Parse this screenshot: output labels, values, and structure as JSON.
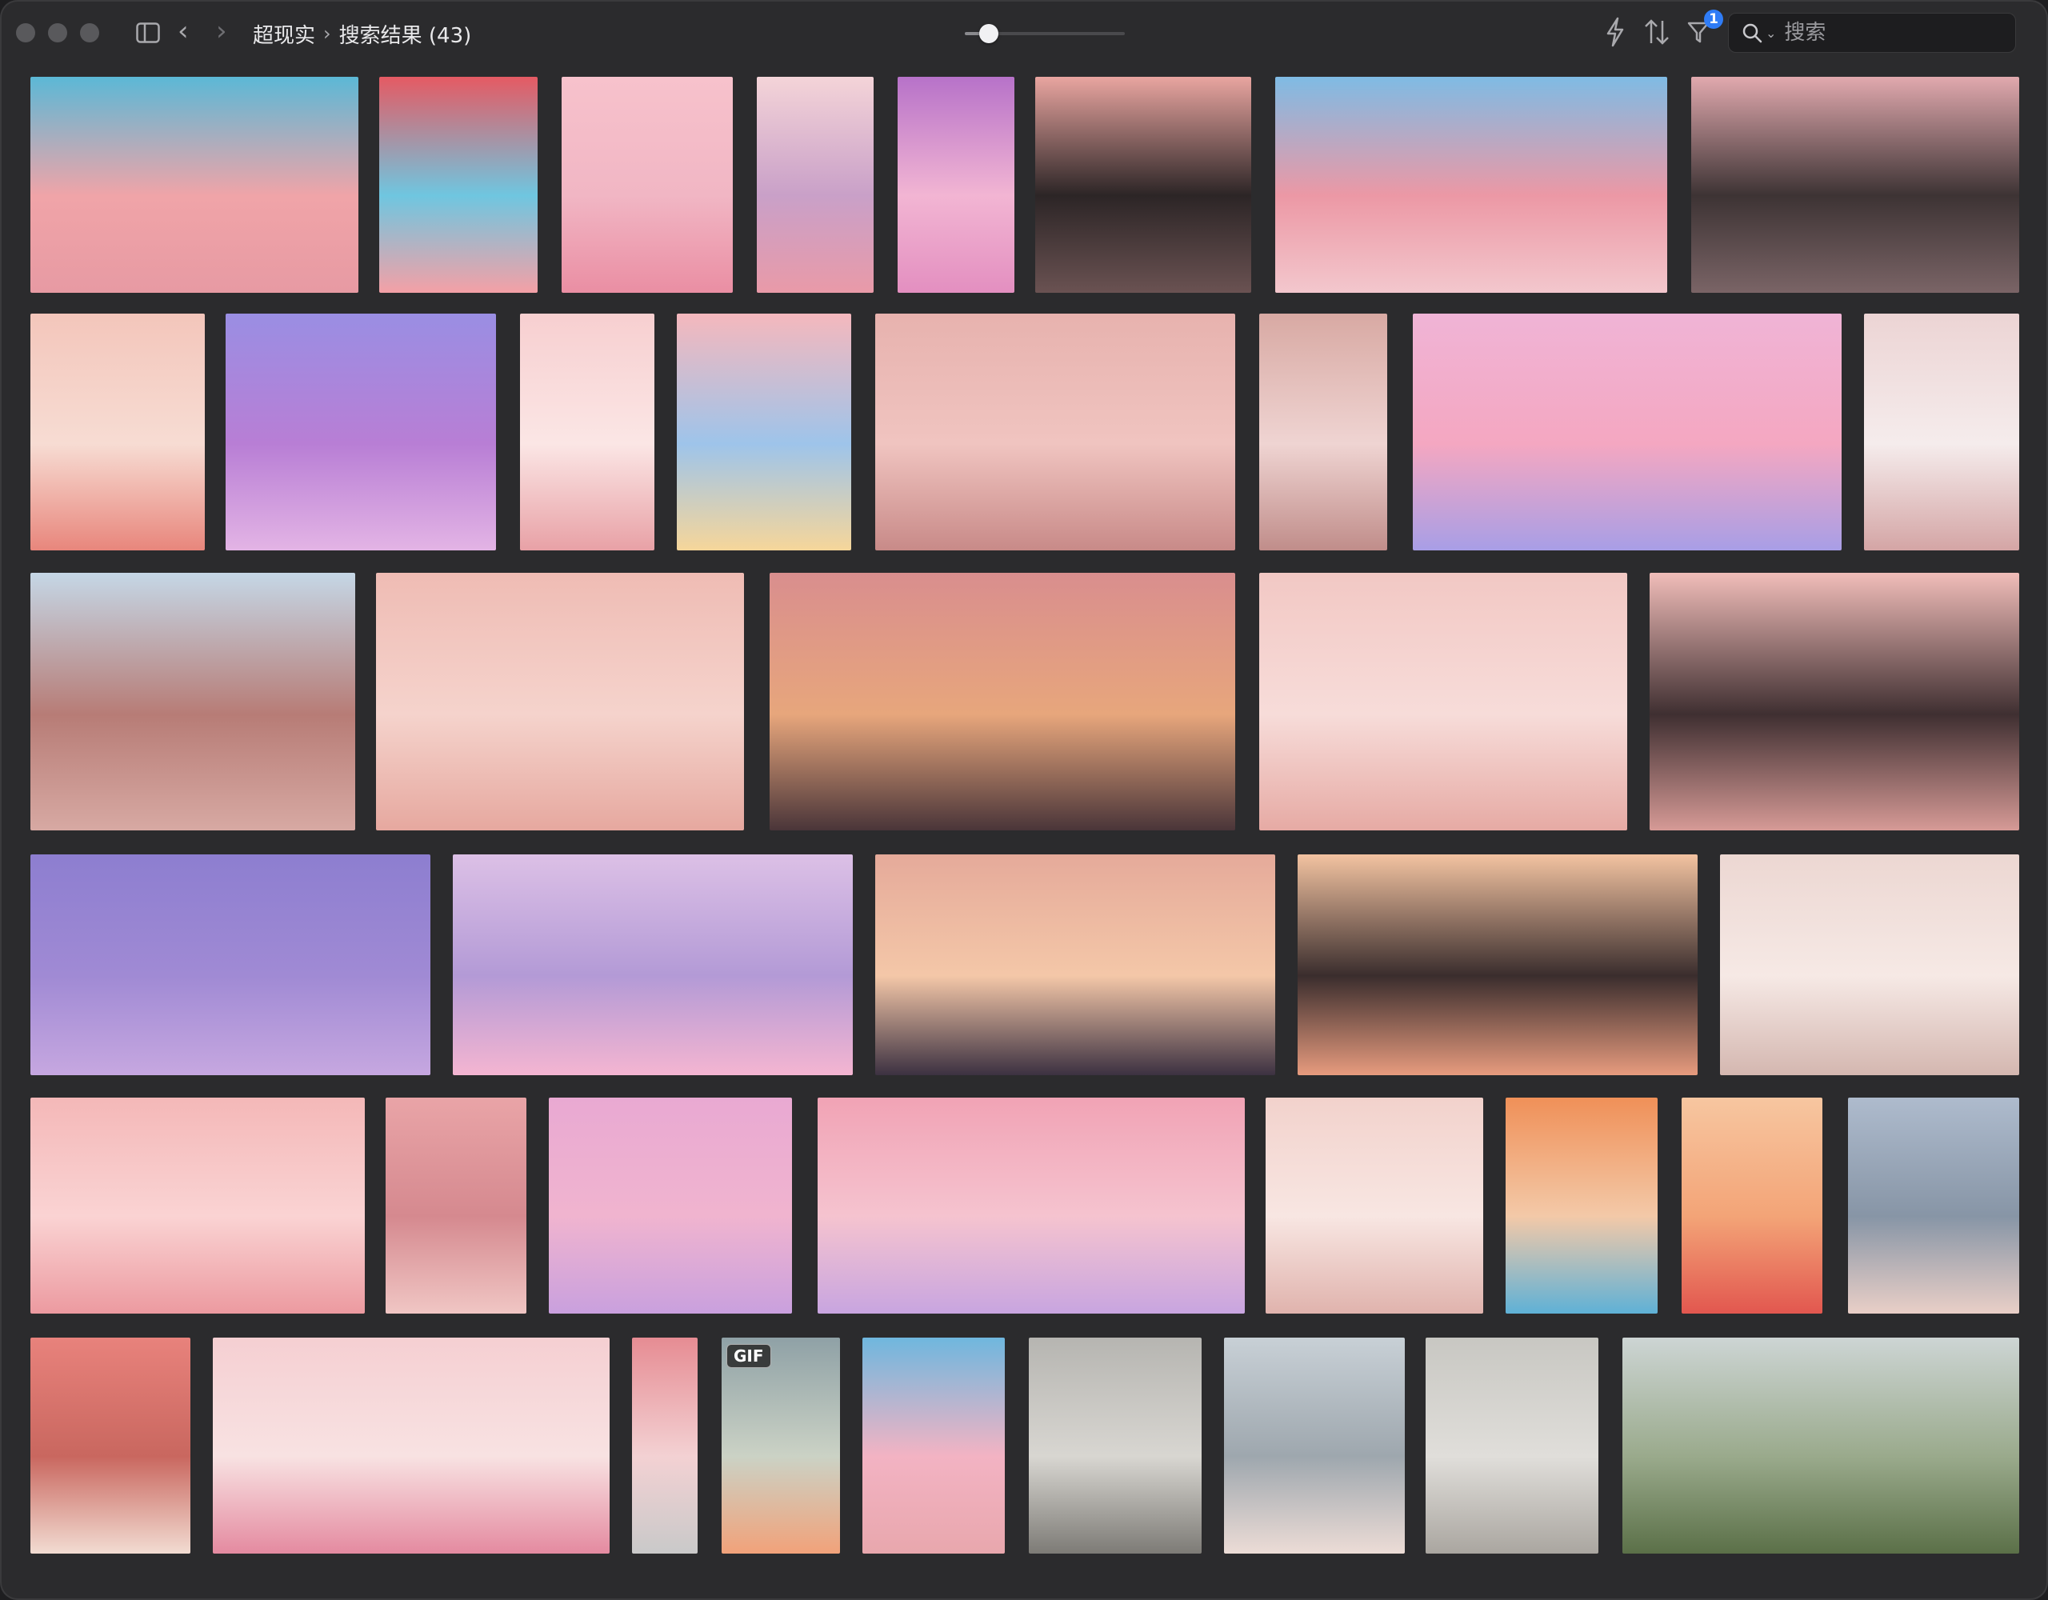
{
  "window": {
    "traffic_lights": [
      "close",
      "minimize",
      "zoom"
    ]
  },
  "toolbar": {
    "sidebar_icon": "sidebar-icon",
    "back_icon": "chevron-left-icon",
    "forward_icon": "chevron-right-icon",
    "breadcrumb": {
      "folder": "超现实",
      "separator": "›",
      "current": "搜索结果 (43)"
    },
    "thumbnail_size": 0.15,
    "bolt_icon": "bolt-icon",
    "sort_icon": "sort-icon",
    "filter_icon": "filter-icon",
    "filter_badge": "1",
    "search": {
      "placeholder": "搜索",
      "value": ""
    }
  },
  "colors": {
    "window_bg": "#2b2b2d",
    "accent_blue": "#2f7cf6"
  },
  "gallery": {
    "result_count": 43,
    "items": [
      {
        "name": "pink-desert-mountains",
        "colors": [
          "#5bb8d6",
          "#e79aa3",
          "#f0a4a8"
        ]
      },
      {
        "name": "pink-castle-poster",
        "colors": [
          "#e55a63",
          "#f4a0a6",
          "#6fc6e0"
        ]
      },
      {
        "name": "pink-tree-cloud",
        "colors": [
          "#f7c2cc",
          "#ea8ea3",
          "#f1b6c4"
        ]
      },
      {
        "name": "bedroom-poster-what",
        "colors": [
          "#f4d4d8",
          "#e99aa8",
          "#c9a0c8"
        ]
      },
      {
        "name": "purple-tmall-poster",
        "colors": [
          "#b772c9",
          "#e38fc0",
          "#f2b5d3"
        ]
      },
      {
        "name": "spiral-tower-dusk",
        "colors": [
          "#e9a5a0",
          "#6a5252",
          "#2c2526"
        ]
      },
      {
        "name": "blue-robot-arches",
        "colors": [
          "#7fbbe4",
          "#f3c7cd",
          "#ec98a5"
        ]
      },
      {
        "name": "rocky-pink-canyon",
        "colors": [
          "#e1a9ae",
          "#7a6466",
          "#3d3334"
        ]
      },
      {
        "name": "coral-product-steps",
        "colors": [
          "#f3c6bb",
          "#e8867c",
          "#f7dcd3"
        ]
      },
      {
        "name": "moon-purple-clouds",
        "colors": [
          "#9a8ee3",
          "#e3b4e5",
          "#b87ed5"
        ]
      },
      {
        "name": "cosmetics-arch",
        "colors": [
          "#f7cfd0",
          "#e8a1a6",
          "#fbe6e5"
        ]
      },
      {
        "name": "pastel-shapes",
        "colors": [
          "#f5b8bd",
          "#f6d69a",
          "#9ec4ea"
        ]
      },
      {
        "name": "pink-valley",
        "colors": [
          "#e7b2ae",
          "#c88a88",
          "#f0c4c0"
        ]
      },
      {
        "name": "satellite-perfume",
        "colors": [
          "#d8a9a3",
          "#c08d8a",
          "#efd4d2"
        ]
      },
      {
        "name": "floating-bubbles-river",
        "colors": [
          "#f0b4d6",
          "#a89ee6",
          "#f4a7c1"
        ]
      },
      {
        "name": "geometric-practice",
        "colors": [
          "#ecd4d4",
          "#d4a5a5",
          "#f5ecec"
        ]
      },
      {
        "name": "sandstone-waves",
        "colors": [
          "#c5d7e6",
          "#d7a9a3",
          "#b77c76"
        ]
      },
      {
        "name": "moon-room",
        "colors": [
          "#efbcb4",
          "#e6a89f",
          "#f5d3cc"
        ]
      },
      {
        "name": "sunset-lake-spheres",
        "colors": [
          "#d98e8e",
          "#4a3539",
          "#e7a67c"
        ]
      },
      {
        "name": "arch-tiles-room",
        "colors": [
          "#f2c8c4",
          "#e6aaa4",
          "#f7dcd9"
        ]
      },
      {
        "name": "round-moon-hall",
        "colors": [
          "#f1bdb9",
          "#d69a96",
          "#3f2f31"
        ]
      },
      {
        "name": "violet-glass-dome",
        "colors": [
          "#8d7ed0",
          "#c6a7e0",
          "#a08ad4"
        ]
      },
      {
        "name": "lilac-valley-river",
        "colors": [
          "#dcc0e6",
          "#f4b5d1",
          "#b39ad6"
        ]
      },
      {
        "name": "dusk-lake-reflection",
        "colors": [
          "#e5aa9a",
          "#3c3141",
          "#f4c7a8"
        ]
      },
      {
        "name": "sunset-orb-lake",
        "colors": [
          "#f3c3a1",
          "#e79b7e",
          "#3a2d2d"
        ]
      },
      {
        "name": "white-dunes-texture",
        "colors": [
          "#ecd7d2",
          "#d4b7b0",
          "#f6e9e5"
        ]
      },
      {
        "name": "headphones-design",
        "colors": [
          "#f4b8b8",
          "#ec9aa0",
          "#fad3d3"
        ]
      },
      {
        "name": "flamingos-lagoon",
        "colors": [
          "#e9a4a7",
          "#f0c6c4",
          "#d5898f"
        ]
      },
      {
        "name": "chair-promo-pink",
        "colors": [
          "#e9a9d2",
          "#c9a0de",
          "#f0b4cf"
        ]
      },
      {
        "name": "bathtub-scene",
        "colors": [
          "#f1a3b5",
          "#c8a5e0",
          "#f5c3cf"
        ]
      },
      {
        "name": "pink-corridor-arches",
        "colors": [
          "#f2d2cc",
          "#e0b3ad",
          "#f8e6e2"
        ]
      },
      {
        "name": "camera-coral-poster",
        "colors": [
          "#f09058",
          "#5fb1d6",
          "#f3c9a8"
        ]
      },
      {
        "name": "cat-flowers-poster",
        "colors": [
          "#f7c6a0",
          "#e2574f",
          "#f3a477"
        ]
      },
      {
        "name": "snow-triangle",
        "colors": [
          "#aebbcd",
          "#e9cfc7",
          "#8795a6"
        ]
      },
      {
        "name": "marble-podium",
        "colors": [
          "#e8827c",
          "#f2dcd2",
          "#c9675f"
        ]
      },
      {
        "name": "pink-dunes-tree",
        "colors": [
          "#f5cfd2",
          "#e48aa0",
          "#f8e2e2"
        ]
      },
      {
        "name": "wine-bottles-tower",
        "colors": [
          "#e68c93",
          "#c9c9c9",
          "#f3d1d3"
        ]
      },
      {
        "name": "gif-tmall-poster",
        "colors": [
          "#8fa1a6",
          "#f1a27a",
          "#cbd2c5"
        ],
        "badge": "GIF"
      },
      {
        "name": "blue-sky-pink-lake",
        "colors": [
          "#6fb7de",
          "#e8a7ad",
          "#f3b3c3"
        ]
      },
      {
        "name": "wooden-cross-sculpture",
        "colors": [
          "#b6b5b1",
          "#7d7b76",
          "#d8d6d1"
        ]
      },
      {
        "name": "white-sculpture-coral",
        "colors": [
          "#c8d0d6",
          "#ecdcd6",
          "#9ea7ae"
        ]
      },
      {
        "name": "stone-stack-ropes",
        "colors": [
          "#c8c7c2",
          "#aaa6a0",
          "#e0deda"
        ]
      },
      {
        "name": "green-hills-lake",
        "colors": [
          "#cdd5d4",
          "#5b7048",
          "#9aaa8c"
        ]
      }
    ]
  }
}
